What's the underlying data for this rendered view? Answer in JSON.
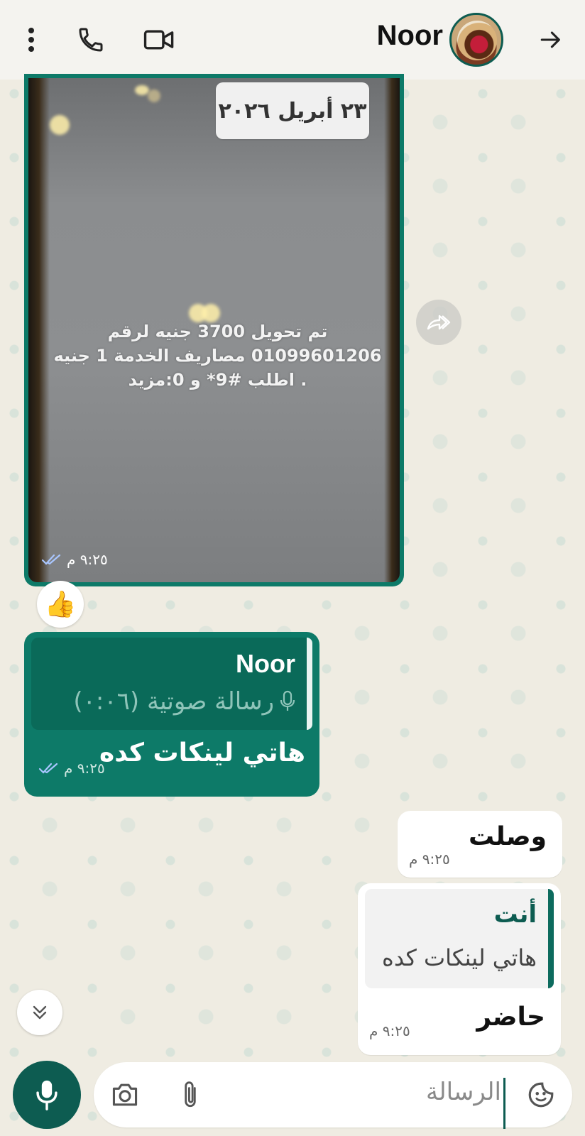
{
  "header": {
    "contact_name": "Noor"
  },
  "date_chip": "٢٣ أبريل ٢٠٢٦",
  "image_message": {
    "text": "تم تحويل 3700 جنيه لرقم 01099601206 مصاريف الخدمة 1 جنيه . اطلب #9* و 0:مزيد",
    "time": "٩:٢٥ م"
  },
  "reaction": "👍",
  "reply_message": {
    "quoted_name": "Noor",
    "quoted_text": "رسالة صوتية (٠:٠٦)",
    "text": "هاتي لينكات كده",
    "time": "٩:٢٥ م"
  },
  "incoming_1": {
    "text": "وصلت",
    "time": "٩:٢٥ م"
  },
  "incoming_2": {
    "quoted_name": "أنت",
    "quoted_text": "هاتي لينكات كده",
    "text": "حاضر",
    "time": "٩:٢٥ م"
  },
  "composer": {
    "placeholder": "الرسالة"
  },
  "colors": {
    "primary": "#0d5c51",
    "outgoing_bubble": "#0d7a68",
    "read_ticks": "#a9c6ff"
  }
}
